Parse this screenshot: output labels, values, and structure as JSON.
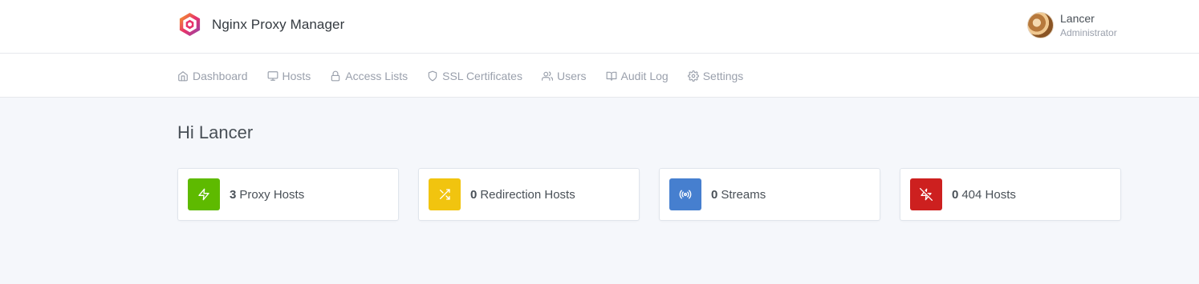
{
  "app": {
    "title": "Nginx Proxy Manager"
  },
  "user": {
    "name": "Lancer",
    "role": "Administrator"
  },
  "nav": {
    "items": [
      {
        "label": "Dashboard",
        "icon": "home-icon"
      },
      {
        "label": "Hosts",
        "icon": "monitor-icon"
      },
      {
        "label": "Access Lists",
        "icon": "lock-icon"
      },
      {
        "label": "SSL Certificates",
        "icon": "shield-icon"
      },
      {
        "label": "Users",
        "icon": "users-icon"
      },
      {
        "label": "Audit Log",
        "icon": "book-icon"
      },
      {
        "label": "Settings",
        "icon": "gear-icon"
      }
    ]
  },
  "greeting": "Hi Lancer",
  "stats": [
    {
      "count": "3",
      "label": "Proxy Hosts",
      "color": "#5eba00",
      "icon": "zap-icon"
    },
    {
      "count": "0",
      "label": "Redirection Hosts",
      "color": "#f1c40f",
      "icon": "shuffle-icon"
    },
    {
      "count": "0",
      "label": "Streams",
      "color": "#467fcf",
      "icon": "radio-icon"
    },
    {
      "count": "0",
      "label": "404 Hosts",
      "color": "#cd201f",
      "icon": "zap-off-icon"
    }
  ]
}
